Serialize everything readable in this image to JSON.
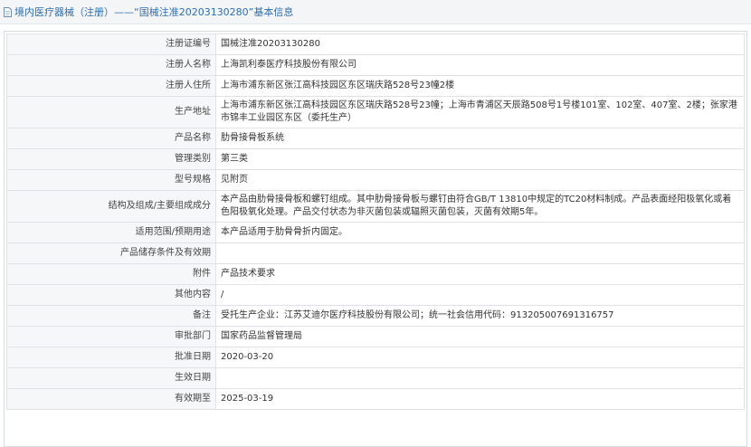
{
  "header": {
    "title": "境内医疗器械（注册）——“国械注准20203130280”基本信息"
  },
  "rows": [
    {
      "label": "注册证编号",
      "value": "国械注准20203130280"
    },
    {
      "label": "注册人名称",
      "value": "上海凯利泰医疗科技股份有限公司"
    },
    {
      "label": "注册人住所",
      "value": "上海市浦东新区张江高科技园区东区瑞庆路528号23幢2楼"
    },
    {
      "label": "生产地址",
      "value": "上海市浦东新区张江高科技园区东区瑞庆路528号23幢；上海市青浦区天辰路508号1号楼101室、102室、407室、2楼；张家港市锦丰工业园区东区（委托生产）"
    },
    {
      "label": "产品名称",
      "value": "肋骨接骨板系统"
    },
    {
      "label": "管理类别",
      "value": "第三类"
    },
    {
      "label": "型号规格",
      "value": "见附页"
    },
    {
      "label": "结构及组成/主要组成成分",
      "value": "本产品由肋骨接骨板和螺钉组成。其中肋骨接骨板与螺钉由符合GB/T 13810中规定的TC20材料制成。产品表面经阳极氧化或着色阳极氧化处理。产品交付状态为非灭菌包装或辐照灭菌包装，灭菌有效期5年。"
    },
    {
      "label": "适用范围/预期用途",
      "value": "本产品适用于肋骨骨折内固定。"
    },
    {
      "label": "产品储存条件及有效期",
      "value": ""
    },
    {
      "label": "附件",
      "value": "产品技术要求"
    },
    {
      "label": "其他内容",
      "value": "/"
    },
    {
      "label": "备注",
      "value": "受托生产企业：江苏艾迪尔医疗科技股份有限公司；统一社会信用代码：913205007691316757"
    },
    {
      "label": "审批部门",
      "value": "国家药品监督管理局"
    },
    {
      "label": "批准日期",
      "value": "2020-03-20"
    },
    {
      "label": "生效日期",
      "value": ""
    },
    {
      "label": "有效期至",
      "value": "2025-03-19"
    }
  ]
}
